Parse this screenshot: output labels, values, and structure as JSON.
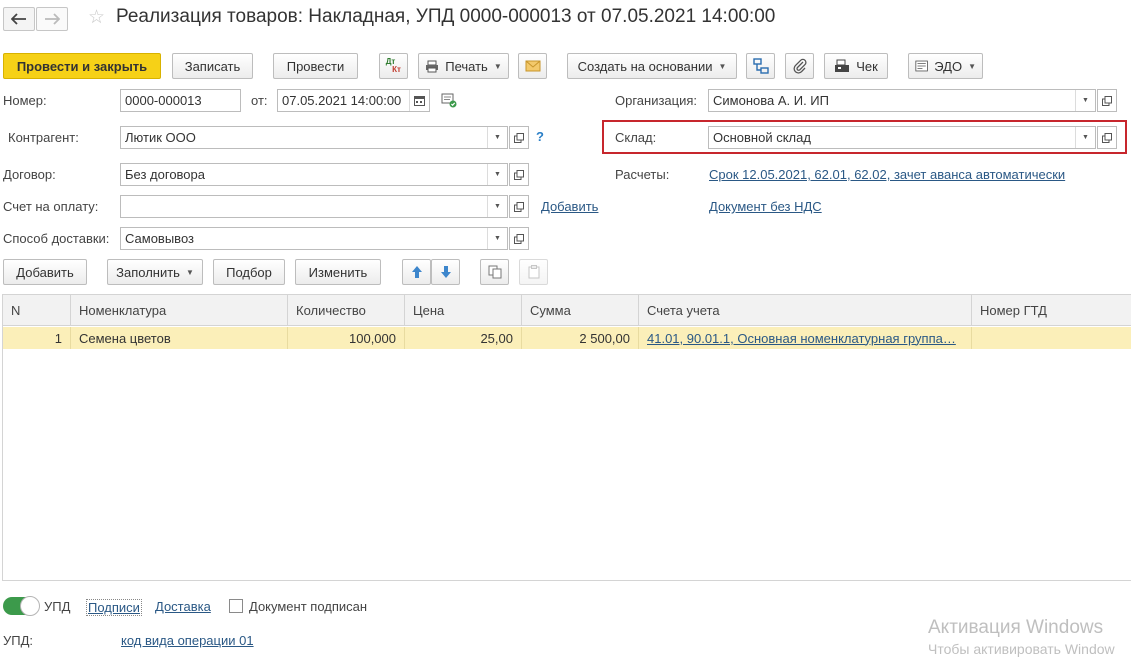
{
  "title": "Реализация товаров: Накладная, УПД 0000-000013 от 07.05.2021 14:00:00",
  "toolbar": {
    "post_close": "Провести и закрыть",
    "save": "Записать",
    "post": "Провести",
    "dtkt_top": "Дт",
    "dtkt_bottom": "Кт",
    "print": "Печать",
    "create_based": "Создать на основании",
    "receipt": "Чек",
    "edo": "ЭДО"
  },
  "form": {
    "number_label": "Номер:",
    "number_value": "0000-000013",
    "date_label": "от:",
    "date_value": "07.05.2021 14:00:00",
    "org_label": "Организация:",
    "org_value": "Симонова А. И. ИП",
    "counterparty_label": "Контрагент:",
    "counterparty_value": "Лютик ООО",
    "help": "?",
    "warehouse_label": "Склад:",
    "warehouse_value": "Основной склад",
    "contract_label": "Договор:",
    "contract_value": "Без договора",
    "settlements_label": "Расчеты:",
    "settlements_link": "Срок 12.05.2021, 62.01, 62.02, зачет аванса автоматически",
    "invoice_label": "Счет на оплату:",
    "invoice_value": "",
    "add_link": "Добавить",
    "vat_link": "Документ без НДС",
    "delivery_label": "Способ доставки:",
    "delivery_value": "Самовывоз"
  },
  "table_toolbar": {
    "add": "Добавить",
    "fill": "Заполнить",
    "pick": "Подбор",
    "change": "Изменить"
  },
  "table": {
    "columns": [
      "N",
      "Номенклатура",
      "Количество",
      "Цена",
      "Сумма",
      "Счета учета",
      "Номер ГТД"
    ],
    "rows": [
      [
        "1",
        "Семена цветов",
        "100,000",
        "25,00",
        "2 500,00",
        "41.01, 90.01.1, Основная номенклатурная группа…",
        ""
      ]
    ]
  },
  "footer": {
    "upd_toggle": "УПД",
    "signatures": "Подписи",
    "delivery": "Доставка",
    "signed": "Документ подписан",
    "upd_label": "УПД:",
    "operation_code": "код вида операции 01"
  },
  "watermark": {
    "line1": "Активация Windows",
    "line2": "Чтобы активировать Window"
  },
  "colors": {
    "accent_yellow": "#f6d117",
    "highlight_red": "#c7262d",
    "row_selected": "#fbefb9",
    "link_blue": "#2a5885",
    "toggle_green": "#3c9a4b"
  }
}
